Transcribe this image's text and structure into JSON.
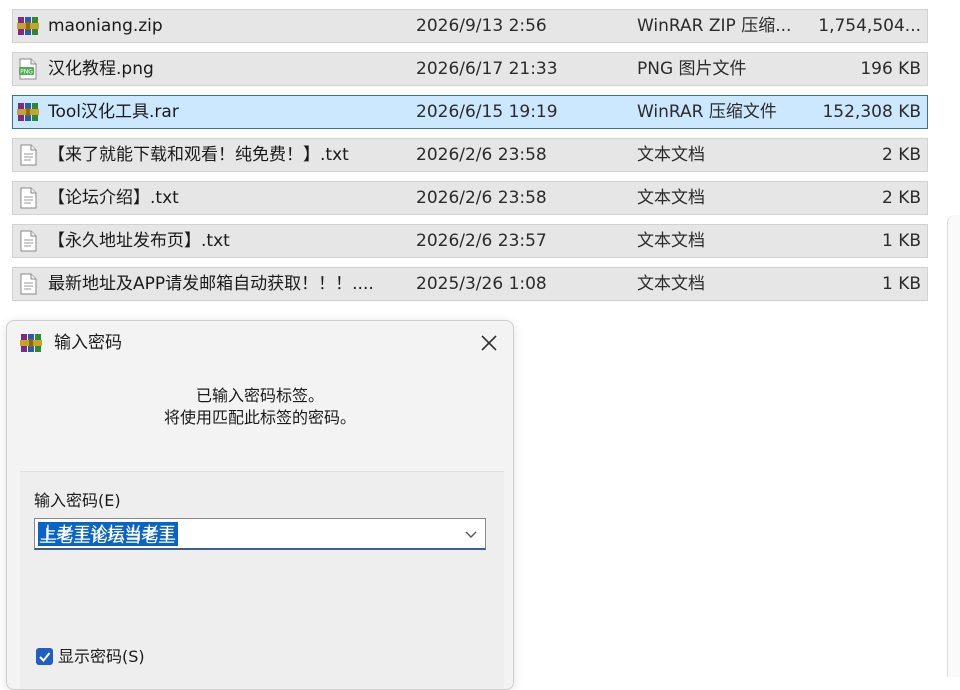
{
  "files": [
    {
      "icon": "winrar-archive-icon",
      "name": "maoniang.zip",
      "date": "2026/9/13 2:56",
      "type": "WinRAR ZIP 压缩...",
      "size": "1,754,504...",
      "selected": false
    },
    {
      "icon": "png-image-icon",
      "name": "汉化教程.png",
      "date": "2026/6/17 21:33",
      "type": "PNG 图片文件",
      "size": "196 KB",
      "selected": false
    },
    {
      "icon": "winrar-archive-icon",
      "name": "Tool汉化工具.rar",
      "date": "2026/6/15 19:19",
      "type": "WinRAR 压缩文件",
      "size": "152,308 KB",
      "selected": true
    },
    {
      "icon": "text-document-icon",
      "name": "【来了就能下载和观看！纯免费！】.txt",
      "date": "2026/2/6 23:58",
      "type": "文本文档",
      "size": "2 KB",
      "selected": false
    },
    {
      "icon": "text-document-icon",
      "name": "【论坛介绍】.txt",
      "date": "2026/2/6 23:58",
      "type": "文本文档",
      "size": "2 KB",
      "selected": false
    },
    {
      "icon": "text-document-icon",
      "name": "【永久地址发布页】.txt",
      "date": "2026/2/6 23:57",
      "type": "文本文档",
      "size": "1 KB",
      "selected": false
    },
    {
      "icon": "text-document-icon",
      "name": "最新地址及APP请发邮箱自动获取！！！....",
      "date": "2025/3/26 1:08",
      "type": "文本文档",
      "size": "1 KB",
      "selected": false
    }
  ],
  "dialog": {
    "title": "输入密码",
    "message_line1": "已输入密码标签。",
    "message_line2": "将使用匹配此标签的密码。",
    "password_label": "输入密码(E)",
    "password_value": "上老王论坛当老王",
    "show_password_label": "显示密码(S)",
    "show_password_checked": true
  },
  "colors": {
    "selected_row_bg": "#cce8ff",
    "selected_row_border": "#3c6e9e",
    "row_bg": "#e6e6e6",
    "text_selection": "#0a64c8",
    "checkbox_accent": "#1f5fbf"
  }
}
